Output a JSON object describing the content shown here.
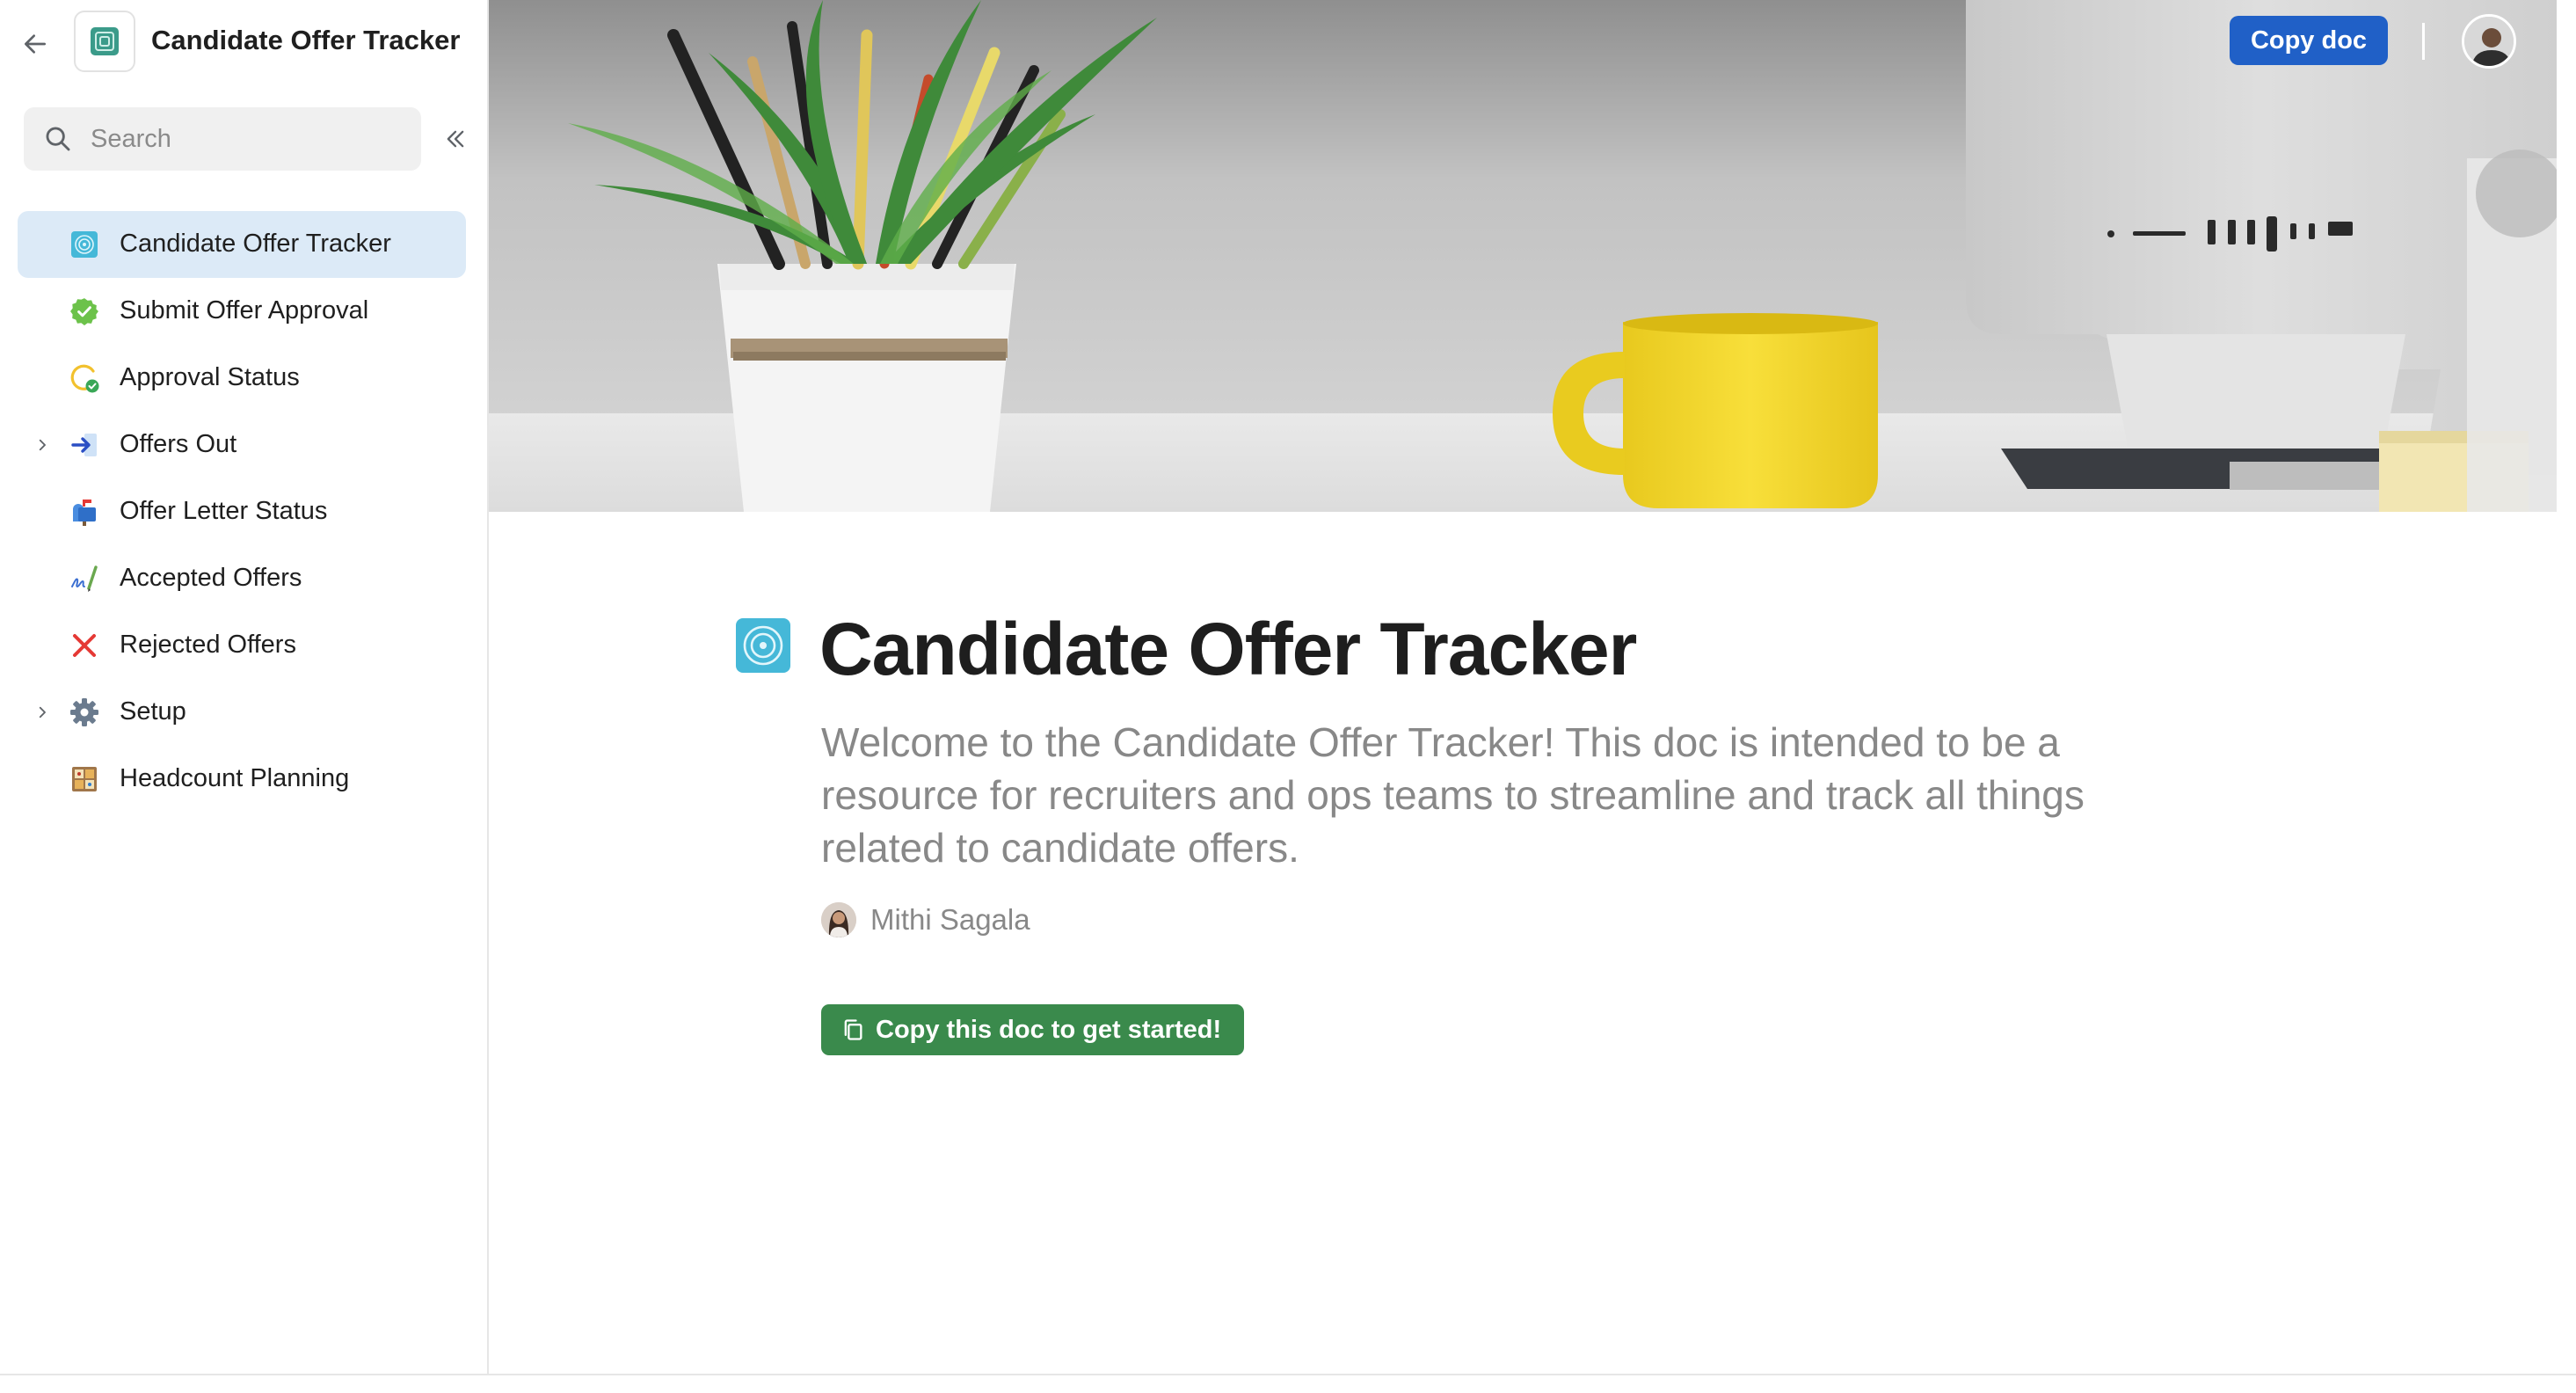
{
  "sidebar": {
    "doc_title": "Candidate Offer Tracker",
    "search_placeholder": "Search",
    "items": [
      {
        "label": "Candidate Offer Tracker",
        "icon": "target-icon",
        "active": true
      },
      {
        "label": "Submit Offer Approval",
        "icon": "verified-badge-icon"
      },
      {
        "label": "Approval Status",
        "icon": "pending-check-icon"
      },
      {
        "label": "Offers Out",
        "icon": "arrow-right-icon",
        "expandable": true
      },
      {
        "label": "Offer Letter Status",
        "icon": "mailbox-icon"
      },
      {
        "label": "Accepted Offers",
        "icon": "signature-pen-icon"
      },
      {
        "label": "Rejected Offers",
        "icon": "red-x-icon"
      },
      {
        "label": "Setup",
        "icon": "gear-icon",
        "expandable": true
      },
      {
        "label": "Headcount Planning",
        "icon": "planning-board-icon"
      }
    ]
  },
  "header": {
    "copy_doc_label": "Copy doc"
  },
  "main": {
    "title": "Candidate Offer Tracker",
    "subtitle": "Welcome to the Candidate Offer Tracker! This doc is intended to be a resource for recruiters and ops teams to streamline and track all things related to candidate offers.",
    "author": "Mithi Sagala",
    "cta_label": "Copy this doc to get started!"
  },
  "colors": {
    "accent_blue": "#2060c7",
    "cta_green": "#3a8a4c",
    "active_nav": "#dceaf7"
  }
}
